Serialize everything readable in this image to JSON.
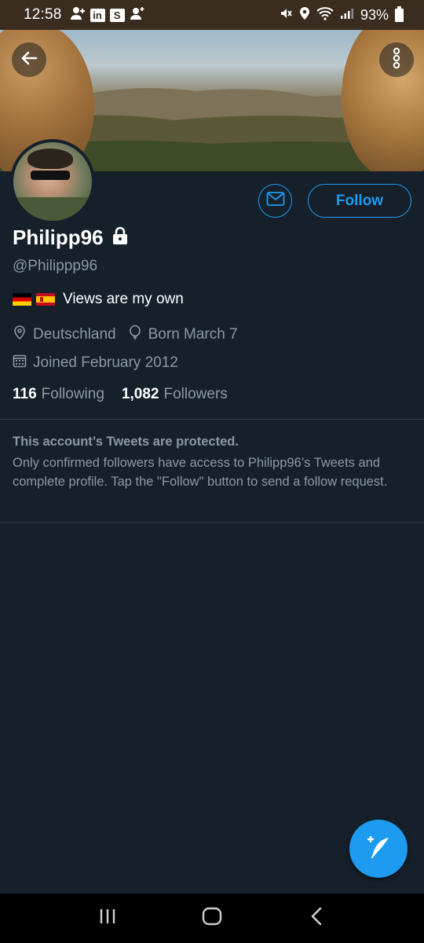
{
  "status_bar": {
    "time": "12:58",
    "battery_percent": "93%",
    "icons_left": [
      "add-person-icon",
      "linkedin-icon",
      "s-icon",
      "add-person-icon"
    ],
    "icons_right": [
      "mute-icon",
      "location-icon",
      "wifi-icon",
      "signal-icon",
      "battery-icon"
    ]
  },
  "header": {
    "back_icon": "arrow-left-icon",
    "more_icon": "more-vertical-icon"
  },
  "profile": {
    "display_name": "Philipp96",
    "protected_icon": "lock-icon",
    "handle": "@Philippp96",
    "bio": "Views are my own",
    "bio_flags": [
      "germany-flag",
      "spain-flag"
    ],
    "location": "Deutschland",
    "birthday": "Born March 7",
    "joined": "Joined February 2012",
    "following_count": "116",
    "following_label": "Following",
    "followers_count": "1,082",
    "followers_label": "Followers"
  },
  "actions": {
    "message_icon": "mail-icon",
    "follow_label": "Follow"
  },
  "protected_notice": {
    "title": "This account’s Tweets are protected.",
    "body": "Only confirmed followers have access to Philipp96’s Tweets and complete profile. Tap the \"Follow\" button to send a follow request."
  },
  "fab": {
    "icon": "compose-tweet-icon"
  },
  "nav_bar": {
    "buttons": [
      "recent-apps-icon",
      "home-icon",
      "back-icon"
    ]
  },
  "colors": {
    "background": "#15202b",
    "accent": "#1d9bf0",
    "secondary_text": "#8b98a5",
    "divider": "#2f3b47"
  }
}
